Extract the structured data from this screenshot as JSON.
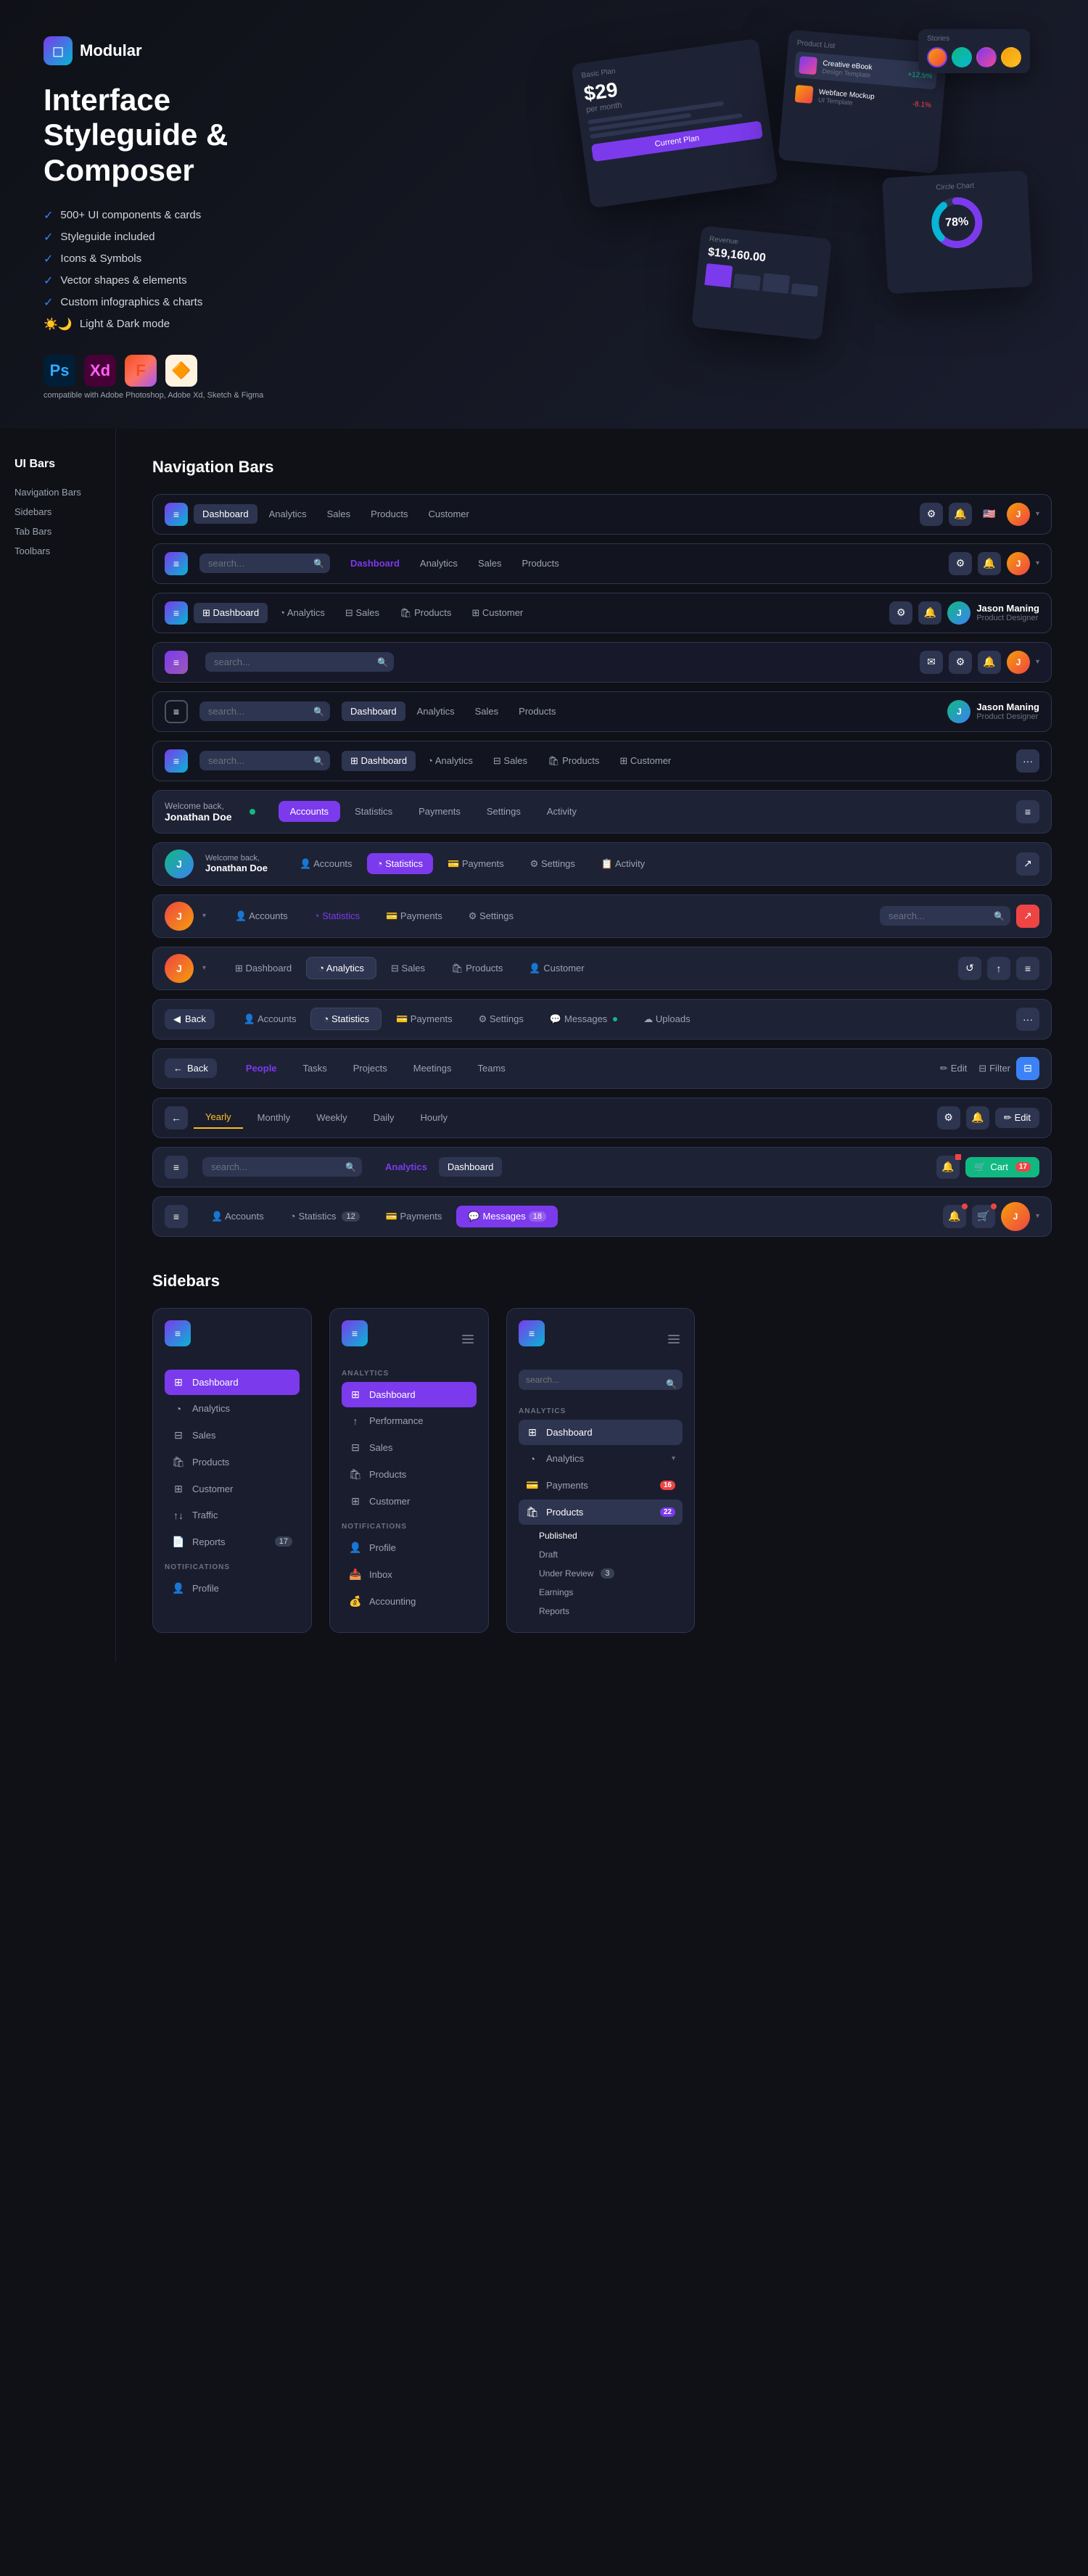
{
  "brand": {
    "name": "Modular",
    "tagline": "Interface Styleguide & Composer"
  },
  "features": [
    "500+ UI components & cards",
    "Styleguide included",
    "Icons & Symbols",
    "Vector shapes & elements",
    "Custom infographics & charts",
    "Light & Dark mode"
  ],
  "tools": {
    "caption": "compatible with Adobe Photoshop, Adobe Xd, Sketch & Figma",
    "items": [
      "Ps",
      "Xd",
      "F",
      "S"
    ]
  },
  "sections": {
    "ui_bars": "UI Bars",
    "navigation_bars": "Navigation Bars",
    "sidebars": "Sidebars",
    "tab_bars": "Tab Bars",
    "toolbars": "Toolbars"
  },
  "sidebar_nav": {
    "items": [
      "Navigation Bars",
      "Sidebars",
      "Tab Bars",
      "Toolbars"
    ]
  },
  "nav_links": {
    "dashboard": "Dashboard",
    "analytics": "Analytics",
    "sales": "Sales",
    "products": "Products",
    "customer": "Customer",
    "accounts": "Accounts",
    "statistics": "Statistics",
    "payments": "Payments",
    "settings": "Settings",
    "activity": "Activity",
    "messages": "Messages",
    "uploads": "Uploads",
    "back": "Back",
    "people": "People",
    "tasks": "Tasks",
    "projects": "Projects",
    "meetings": "Meetings",
    "teams": "Teams",
    "yearly": "Yearly",
    "monthly": "Monthly",
    "weekly": "Weekly",
    "daily": "Daily",
    "hourly": "Hourly",
    "edit": "Edit",
    "filter": "Filter",
    "cart": "Cart",
    "search_placeholder": "search..."
  },
  "user": {
    "name": "Jason Maning",
    "role": "Product Designer",
    "welcome": "Welcome back,\nJonathan Doe"
  },
  "badges": {
    "messages_count": "18",
    "products_count": "22",
    "payments_count": "16",
    "statistics_count": "12",
    "cart_count": "17",
    "reports_count": "17",
    "under_review_count": "3"
  },
  "sidebar_items": {
    "col1": {
      "active": "Dashboard",
      "items": [
        "Analytics",
        "Sales",
        "Products",
        "Customer",
        "Traffic",
        "Reports"
      ],
      "notifications_label": "NOTIFICATIONS",
      "notif_items": [
        "Profile"
      ]
    },
    "col2": {
      "analytics_label": "ANALYTICS",
      "items": [
        "Dashboard",
        "Performance",
        "Sales",
        "Products",
        "Customer"
      ],
      "notifications_label": "NOTIFICATIONS",
      "notif_items": [
        "Profile",
        "Inbox",
        "Accounting"
      ]
    },
    "col3": {
      "analytics_label": "ANALYTICS",
      "items": [
        "Dashboard",
        "Analytics",
        "Payments",
        "Products"
      ],
      "sub_items": [
        "Published",
        "Draft",
        "Under Review",
        "Earnings",
        "Reports"
      ]
    }
  }
}
